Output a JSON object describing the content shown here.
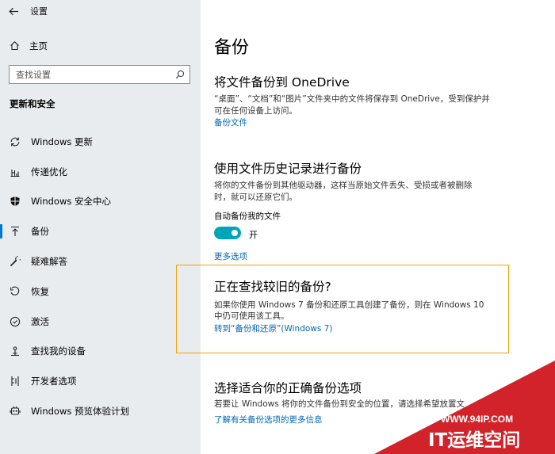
{
  "window": {
    "title": "设置"
  },
  "sidebar": {
    "home_label": "主页",
    "search_placeholder": "查找设置",
    "section_title": "更新和安全",
    "items": [
      {
        "label": "Windows 更新",
        "icon": "sync-icon"
      },
      {
        "label": "传递优化",
        "icon": "delivery-optimization-icon"
      },
      {
        "label": "Windows 安全中心",
        "icon": "shield-icon"
      },
      {
        "label": "备份",
        "icon": "backup-arrow-icon",
        "active": true
      },
      {
        "label": "疑难解答",
        "icon": "wrench-icon"
      },
      {
        "label": "恢复",
        "icon": "recovery-icon"
      },
      {
        "label": "激活",
        "icon": "check-circle-icon"
      },
      {
        "label": "查找我的设备",
        "icon": "find-device-icon"
      },
      {
        "label": "开发者选项",
        "icon": "developer-icon"
      },
      {
        "label": "Windows 预览体验计划",
        "icon": "insider-icon"
      }
    ]
  },
  "main": {
    "title": "备份",
    "onedrive": {
      "heading": "将文件备份到 OneDrive",
      "desc_line1": "“桌面”、“文档”和“图片”文件夹中的文件将保存到 OneDrive，受到保护并",
      "desc_line2": "可在任何设备上访问。",
      "link": "备份文件"
    },
    "file_history": {
      "heading": "使用文件历史记录进行备份",
      "desc_line1": "将你的文件备份到其他驱动器，这样当原始文件丢失、受损或者被删除",
      "desc_line2": "时，就可以还原它们。",
      "auto_label": "自动备份我的文件",
      "toggle_state": "开",
      "toggle_on": true,
      "more_link": "更多选项"
    },
    "older_backup": {
      "heading": "正在查找较旧的备份?",
      "desc_line1": "如果你使用 Windows 7 备份和还原工具创建了备份，则在 Windows 10",
      "desc_line2": "中仍可使用该工具。",
      "link": "转到“备份和还原”(Windows 7)"
    },
    "choose": {
      "heading": "选择适合你的正确备份选项",
      "desc": "若要让 Windows 将你的文件备份到安全的位置，请选择希望放置文",
      "link": "了解有关备份选项的更多信息"
    }
  },
  "watermark": {
    "url": "WWW.94IP.COM",
    "brand": "IT运维空间"
  },
  "colors": {
    "sidebar_bg": "#e9ecef",
    "accent": "#0078d7",
    "link": "#0067b8",
    "toggle_on": "#00a6b8",
    "highlight": "#f0a30a",
    "watermark_red": "#d2232a"
  }
}
